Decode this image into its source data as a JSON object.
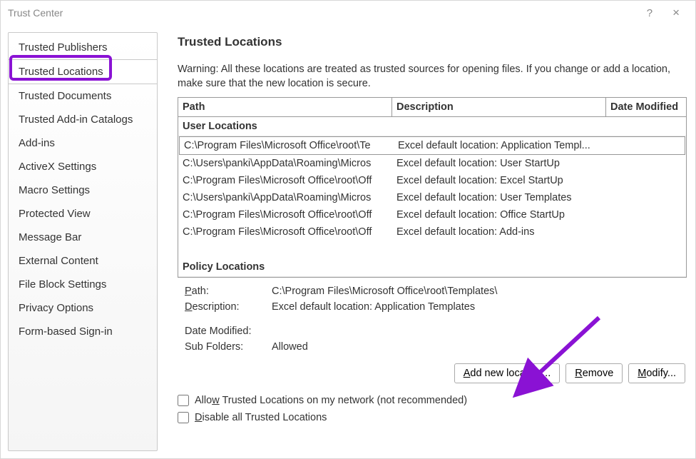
{
  "window": {
    "title": "Trust Center"
  },
  "sidebar": {
    "items": [
      "Trusted Publishers",
      "Trusted Locations",
      "Trusted Documents",
      "Trusted Add-in Catalogs",
      "Add-ins",
      "ActiveX Settings",
      "Macro Settings",
      "Protected View",
      "Message Bar",
      "External Content",
      "File Block Settings",
      "Privacy Options",
      "Form-based Sign-in"
    ],
    "selected_index": 1
  },
  "content": {
    "heading": "Trusted Locations",
    "warning": "Warning: All these locations are treated as trusted sources for opening files.  If you change or add a location, make sure that the new location is secure.",
    "columns": {
      "path": "Path",
      "desc": "Description",
      "date": "Date Modified"
    },
    "user_section": "User Locations",
    "policy_section": "Policy Locations",
    "rows": [
      {
        "path": "C:\\Program Files\\Microsoft Office\\root\\Te",
        "desc": "Excel default location: Application Templ...",
        "selected": true
      },
      {
        "path": "C:\\Users\\panki\\AppData\\Roaming\\Micros",
        "desc": "Excel default location: User StartUp"
      },
      {
        "path": "C:\\Program Files\\Microsoft Office\\root\\Off",
        "desc": "Excel default location: Excel StartUp"
      },
      {
        "path": "C:\\Users\\panki\\AppData\\Roaming\\Micros",
        "desc": "Excel default location: User Templates"
      },
      {
        "path": "C:\\Program Files\\Microsoft Office\\root\\Off",
        "desc": "Excel default location: Office StartUp"
      },
      {
        "path": "C:\\Program Files\\Microsoft Office\\root\\Off",
        "desc": "Excel default location: Add-ins"
      }
    ],
    "details": {
      "path_label": "ath:",
      "path_value": "C:\\Program Files\\Microsoft Office\\root\\Templates\\",
      "desc_label": "escription:",
      "desc_value": "Excel default location: Application Templates",
      "date_label": "Date Modified:",
      "date_value": "",
      "sub_label": "Sub Folders:",
      "sub_value": "Allowed"
    },
    "buttons": {
      "add": "dd new location...",
      "remove": "emove",
      "modify": "odify..."
    },
    "checks": {
      "allow": " Trusted Locations on my network (not recommended)",
      "allow_pre": "Allo",
      "allow_u": "w",
      "disable_pre": "",
      "disable_u": "D",
      "disable": "isable all Trusted Locations"
    }
  }
}
